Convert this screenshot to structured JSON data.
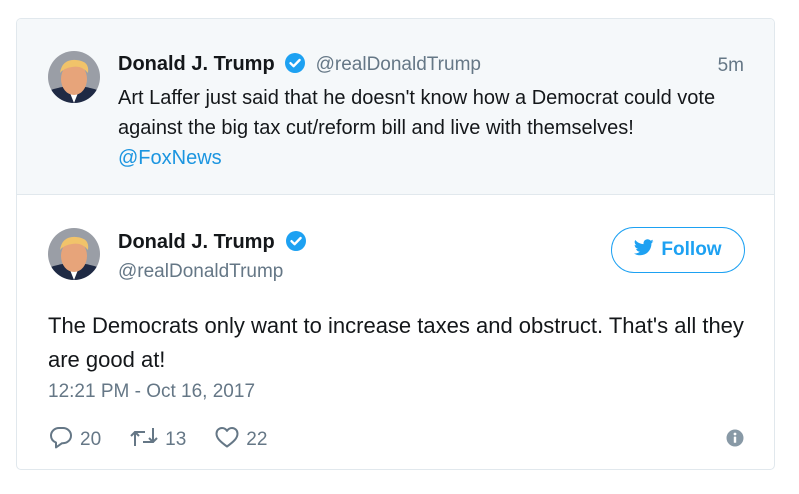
{
  "parent_tweet": {
    "name": "Donald J. Trump",
    "handle": "@realDonaldTrump",
    "time": "5m",
    "text": "Art Laffer just said that he doesn't know how a Democrat could vote against the big tax cut/reform bill and live with themselves!",
    "mention": "@FoxNews"
  },
  "main_tweet": {
    "name": "Donald J. Trump",
    "handle": "@realDonaldTrump",
    "follow_label": "Follow",
    "text": "The Democrats only want to increase taxes and obstruct. That's all they are good at!",
    "timestamp": "12:21 PM - Oct 16, 2017",
    "replies": "20",
    "retweets": "13",
    "likes": "22"
  },
  "icons": [
    "verified-badge-icon",
    "twitter-bird-icon",
    "reply-icon",
    "retweet-icon",
    "like-heart-icon",
    "info-icon"
  ],
  "colors": {
    "accent": "#1da1f2",
    "link": "#1b95e0",
    "muted": "#657786",
    "parent_bg": "#f5f8fa",
    "border": "#e1e8ed"
  }
}
